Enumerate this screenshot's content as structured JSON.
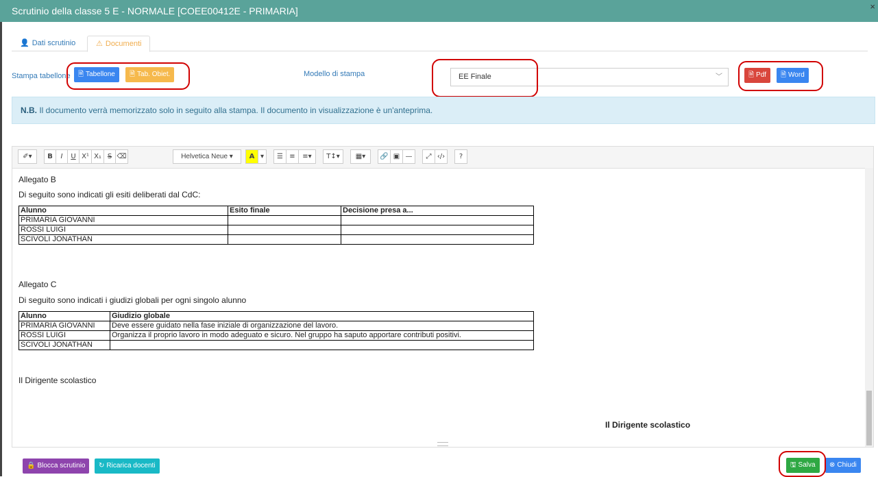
{
  "window": {
    "title": "Scrutinio della classe 5 E - NORMALE [COEE00412E - PRIMARIA]",
    "close": "×"
  },
  "tabs": [
    {
      "label": "Dati scrutinio"
    },
    {
      "label": "Documenti"
    }
  ],
  "print": {
    "label": "Stampa tabellone",
    "tabellone": "Tabellone",
    "tab_obiet": "Tab. Obiet.",
    "modello_label": "Modello di stampa",
    "modello_value": "EE Finale",
    "pdf": "Pdf",
    "word": "Word"
  },
  "notice": {
    "bold": "N.B.",
    "text": " Il documento verrà memorizzato solo in seguito alla stampa. Il documento in visualizzazione è un'anteprima."
  },
  "toolbar": {
    "font": "Helvetica Neue",
    "bold": "B",
    "italic": "I",
    "underline": "U",
    "sup": "X¹",
    "sub": "X₁",
    "strike": "S",
    "color": "A",
    "textsize": "T↕"
  },
  "doc": {
    "allegato_b": "Allegato B",
    "b_intro": "Di seguito sono indicati gli esiti deliberati dal CdC:",
    "b_headers": [
      "Alunno",
      "Esito finale",
      "Decisione presa a..."
    ],
    "b_rows": [
      [
        "PRIMARIA GIOVANNI",
        "",
        ""
      ],
      [
        "ROSSI LUIGI",
        "",
        ""
      ],
      [
        "SCIVOLI JONATHAN",
        "",
        ""
      ]
    ],
    "allegato_c": "Allegato C",
    "c_intro": "Di seguito sono indicati i giudizi globali per ogni singolo alunno",
    "c_headers": [
      "Alunno",
      "Giudizio globale"
    ],
    "c_rows": [
      [
        "PRIMARIA GIOVANNI",
        "Deve essere guidato nella fase iniziale di organizzazione del lavoro."
      ],
      [
        "ROSSI LUIGI",
        "Organizza il proprio lavoro in modo adeguato e sicuro. Nel gruppo ha saputo apportare contributi positivi."
      ],
      [
        "SCIVOLI JONATHAN",
        ""
      ]
    ],
    "dirigente": "Il Dirigente scolastico",
    "dirigente_sign": "Il Dirigente scolastico"
  },
  "footer": {
    "blocca": "Blocca scrutinio",
    "ricarica": "Ricarica docenti",
    "salva": "Salva",
    "chiudi": "Chiudi"
  }
}
